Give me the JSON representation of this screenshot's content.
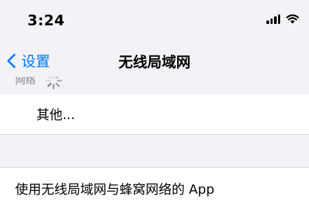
{
  "status_bar": {
    "time": "3:24"
  },
  "nav": {
    "back_label": "设置",
    "title": "无线局域网"
  },
  "section": {
    "header_label": "网络"
  },
  "list": {
    "other_label": "其他..."
  },
  "settings": {
    "apps_using_wlan_label": "使用无线局域网与蜂窝网络的 App"
  },
  "colors": {
    "accent": "#007aff",
    "background": "#f2f2f7",
    "cell": "#ffffff",
    "separator": "#d6d6db",
    "secondary_text": "#8a8a8e"
  }
}
